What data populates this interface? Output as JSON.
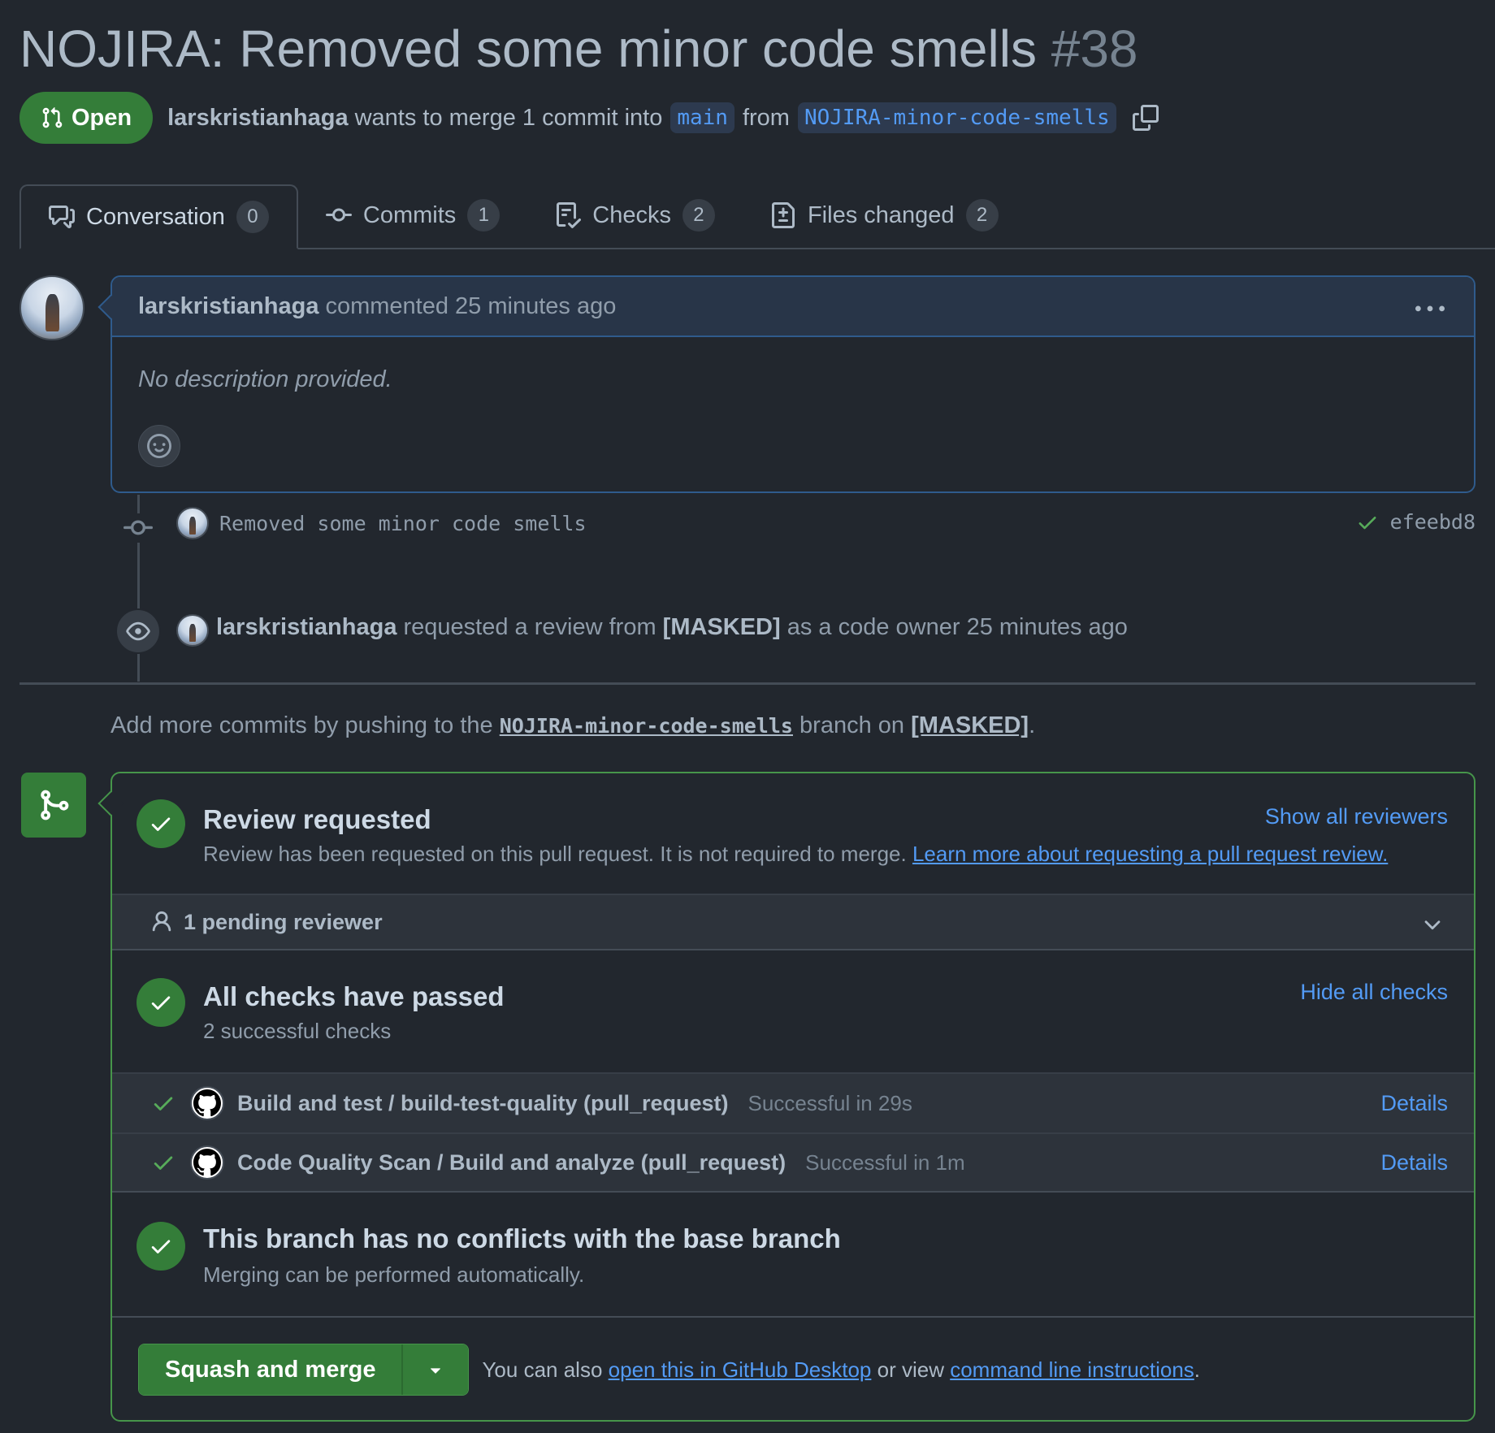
{
  "pr": {
    "title": "NOJIRA: Removed some minor code smells",
    "number": "#38",
    "state": "Open",
    "author": "larskristianhaga",
    "merge_text": "wants to merge 1 commit into",
    "base_branch": "main",
    "from_text": "from",
    "head_branch": "NOJIRA-minor-code-smells"
  },
  "tabs": [
    {
      "label": "Conversation",
      "count": "0",
      "icon": "comment-discussion-icon"
    },
    {
      "label": "Commits",
      "count": "1",
      "icon": "git-commit-icon"
    },
    {
      "label": "Checks",
      "count": "2",
      "icon": "checklist-icon"
    },
    {
      "label": "Files changed",
      "count": "2",
      "icon": "file-diff-icon"
    }
  ],
  "comment": {
    "author": "larskristianhaga",
    "meta": "commented 25 minutes ago",
    "body": "No description provided."
  },
  "timeline": {
    "commit_message": "Removed some minor code smells",
    "commit_sha": "efeebd8",
    "review_actor": "larskristianhaga",
    "review_text1": "requested a review from",
    "review_target": "[MASKED]",
    "review_text2": "as a code owner 25 minutes ago"
  },
  "push_note": {
    "prefix": "Add more commits by pushing to the",
    "branch": "NOJIRA-minor-code-smells",
    "middle": "branch on",
    "repo": "[MASKED]",
    "suffix": "."
  },
  "merge_box": {
    "review": {
      "title": "Review requested",
      "subtitle": "Review has been requested on this pull request. It is not required to merge.",
      "learn_link": "Learn more about requesting a pull request review.",
      "action": "Show all reviewers",
      "pending": "1 pending reviewer"
    },
    "checks": {
      "title": "All checks have passed",
      "subtitle": "2 successful checks",
      "action": "Hide all checks",
      "items": [
        {
          "name": "Build and test / build-test-quality (pull_request)",
          "status": "Successful in 29s",
          "details": "Details"
        },
        {
          "name": "Code Quality Scan / Build and analyze (pull_request)",
          "status": "Successful in 1m",
          "details": "Details"
        }
      ]
    },
    "conflicts": {
      "title": "This branch has no conflicts with the base branch",
      "subtitle": "Merging can be performed automatically."
    },
    "footer": {
      "button": "Squash and merge",
      "text1": "You can also",
      "link1": "open this in GitHub Desktop",
      "text2": "or view",
      "link2": "command line instructions",
      "text3": "."
    }
  },
  "colors": {
    "background": "#22272e",
    "accent_green": "#347d39",
    "link_blue": "#539bf5"
  }
}
